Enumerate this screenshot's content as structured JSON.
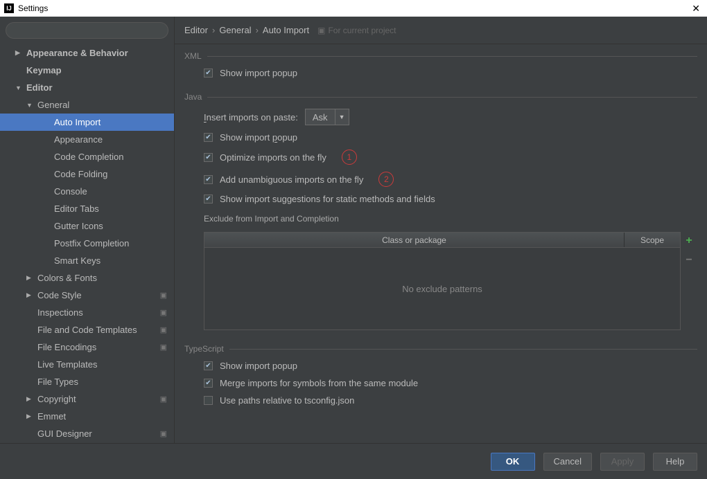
{
  "window": {
    "title": "Settings"
  },
  "search": {
    "placeholder": ""
  },
  "sidebar": {
    "items": [
      {
        "label": "Appearance & Behavior",
        "level": 1,
        "arrow": "right"
      },
      {
        "label": "Keymap",
        "level": 1,
        "arrow": ""
      },
      {
        "label": "Editor",
        "level": 1,
        "arrow": "down"
      },
      {
        "label": "General",
        "level": 2,
        "arrow": "down"
      },
      {
        "label": "Auto Import",
        "level": 3,
        "arrow": "",
        "selected": true
      },
      {
        "label": "Appearance",
        "level": 3,
        "arrow": ""
      },
      {
        "label": "Code Completion",
        "level": 3,
        "arrow": ""
      },
      {
        "label": "Code Folding",
        "level": 3,
        "arrow": ""
      },
      {
        "label": "Console",
        "level": 3,
        "arrow": ""
      },
      {
        "label": "Editor Tabs",
        "level": 3,
        "arrow": ""
      },
      {
        "label": "Gutter Icons",
        "level": 3,
        "arrow": ""
      },
      {
        "label": "Postfix Completion",
        "level": 3,
        "arrow": ""
      },
      {
        "label": "Smart Keys",
        "level": 3,
        "arrow": ""
      },
      {
        "label": "Colors & Fonts",
        "level": 2,
        "arrow": "right"
      },
      {
        "label": "Code Style",
        "level": 2,
        "arrow": "right",
        "proj": true
      },
      {
        "label": "Inspections",
        "level": 2,
        "arrow": "",
        "proj": true
      },
      {
        "label": "File and Code Templates",
        "level": 2,
        "arrow": "",
        "proj": true
      },
      {
        "label": "File Encodings",
        "level": 2,
        "arrow": "",
        "proj": true
      },
      {
        "label": "Live Templates",
        "level": 2,
        "arrow": ""
      },
      {
        "label": "File Types",
        "level": 2,
        "arrow": ""
      },
      {
        "label": "Copyright",
        "level": 2,
        "arrow": "right",
        "proj": true
      },
      {
        "label": "Emmet",
        "level": 2,
        "arrow": "right"
      },
      {
        "label": "GUI Designer",
        "level": 2,
        "arrow": "",
        "proj": true
      }
    ]
  },
  "breadcrumb": {
    "parts": [
      "Editor",
      "General",
      "Auto Import"
    ],
    "hint": "For current project"
  },
  "sections": {
    "xml": {
      "legend": "XML",
      "show_popup": "Show import popup"
    },
    "java": {
      "legend": "Java",
      "insert_label": "Insert imports on paste:",
      "insert_value": "Ask",
      "show_popup": "Show import popup",
      "optimize": "Optimize imports on the fly",
      "unambiguous": "Add unambiguous imports on the fly",
      "static_suggest": "Show import suggestions for static methods and fields",
      "exclude_label": "Exclude from Import and Completion",
      "col1": "Class or package",
      "col2": "Scope",
      "empty": "No exclude patterns",
      "badge1": "1",
      "badge2": "2"
    },
    "ts": {
      "legend": "TypeScript",
      "show_popup": "Show import popup",
      "merge": "Merge imports for symbols  from the same module",
      "paths": "Use paths relative to tsconfig.json"
    }
  },
  "footer": {
    "ok": "OK",
    "cancel": "Cancel",
    "apply": "Apply",
    "help": "Help"
  }
}
